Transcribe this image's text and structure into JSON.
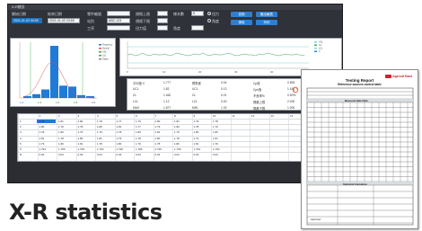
{
  "window": {
    "title": "X-R統計"
  },
  "toolbar": {
    "fields": [
      {
        "label": "開始日期",
        "value": "2021-01-02 00:00"
      },
      {
        "label": "結束日期",
        "value": "2021-01-02 23:59"
      },
      {
        "label": "零件編號",
        "value": ""
      },
      {
        "label": "站別",
        "value": "ABC-123"
      },
      {
        "label": "工序",
        "value": ""
      },
      {
        "label": "規格上限",
        "value": ""
      },
      {
        "label": "規格下限",
        "value": ""
      },
      {
        "label": "扭力值",
        "value": ""
      },
      {
        "label": "樣本數",
        "value": "5"
      },
      {
        "label": "角度",
        "value": ""
      }
    ],
    "radio_labels": [
      "扭力",
      "角度"
    ],
    "buttons": [
      "查詢",
      "匯出報表",
      "清除",
      "列印"
    ]
  },
  "histogram": {
    "legend": [
      "Frequency",
      "Normal",
      "USL",
      "LSL",
      "Target"
    ],
    "bars": [
      2,
      4,
      9,
      55,
      13,
      12,
      3,
      2
    ],
    "x_ticks": [
      "1.2",
      "1.4",
      "1.6",
      "1.8",
      "2.0"
    ]
  },
  "trend": {
    "legend": [
      "UCL",
      "CL",
      "LCL",
      "X"
    ],
    "x_ticks": [
      "0",
      "10",
      "20",
      "30",
      "40",
      "50"
    ]
  },
  "stats": {
    "rows": [
      [
        "平均值 X",
        "1.777",
        "標準差",
        "0.04",
        "Cp值",
        "0.893"
      ],
      [
        "UCL",
        "1.82",
        "UCL",
        "0.13",
        "Cpk值",
        "1.162"
      ],
      [
        "CL",
        "1.462",
        "CL",
        "0.01",
        "不良率%",
        "0.50%"
      ],
      [
        "LCL",
        "1.12",
        "LCL",
        "0.00",
        "規格上限",
        "2.000"
      ],
      [
        "MAX",
        "1.877",
        "MIN",
        "1.33",
        "規格下限",
        "1.000"
      ]
    ]
  },
  "grid": {
    "headers": [
      "",
      "1",
      "2",
      "3",
      "4",
      "5",
      "6",
      "7",
      "8",
      "9",
      "10",
      "11",
      "12",
      "13",
      "14",
      "15",
      "16"
    ],
    "rows": [
      [
        "1",
        "1.79",
        "1.81",
        "1.80",
        "1.78",
        "1.77",
        "1.79",
        "1.80",
        "1.81",
        "1.79",
        "1.78"
      ],
      [
        "2",
        "1.80",
        "1.79",
        "1.78",
        "1.80",
        "1.81",
        "1.77",
        "1.79",
        "1.80",
        "1.78",
        "1.79"
      ],
      [
        "3",
        "1.78",
        "1.80",
        "1.79",
        "1.79",
        "1.78",
        "1.80",
        "1.81",
        "1.79",
        "1.80",
        "1.80"
      ],
      [
        "4",
        "1.81",
        "1.78",
        "1.80",
        "1.81",
        "1.79",
        "1.78",
        "1.80",
        "1.78",
        "1.79",
        "1.81"
      ],
      [
        "5",
        "1.79",
        "1.80",
        "1.81",
        "1.78",
        "1.80",
        "1.79",
        "1.78",
        "1.80",
        "1.81",
        "1.79"
      ],
      [
        "X̄",
        "1.794",
        "1.796",
        "1.796",
        "1.792",
        "1.790",
        "1.786",
        "1.796",
        "1.796",
        "1.794",
        "1.794"
      ],
      [
        "R",
        "0.03",
        "0.03",
        "0.03",
        "0.03",
        "0.04",
        "0.03",
        "0.03",
        "0.03",
        "0.03",
        "0.03"
      ]
    ]
  },
  "heading": "X-R statistics",
  "report": {
    "title": "Testing Report",
    "subtitle": "Reference sources control table",
    "logo": "Ingersoll Rand",
    "section1": "Measured Data Table",
    "section2": "Statistical Calculation",
    "footer_label": "Approved"
  }
}
